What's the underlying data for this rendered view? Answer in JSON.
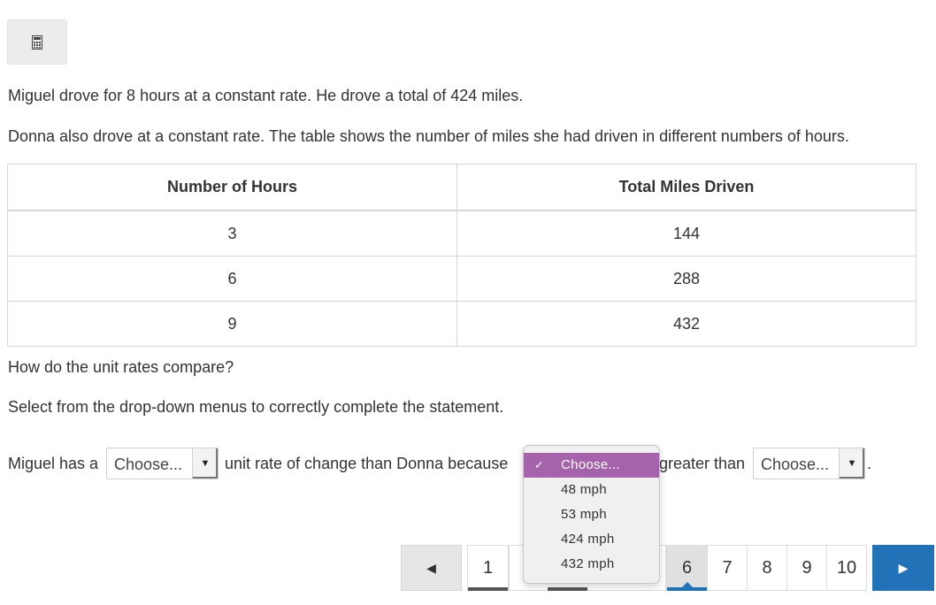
{
  "toolbar": {
    "calculator_icon": "calculator-icon"
  },
  "passage": {
    "line1": "Miguel drove for 8 hours at a constant rate. He drove a total of 424 miles.",
    "line2": "Donna also drove at a constant rate. The table shows the number of miles she had driven in different numbers of hours."
  },
  "table": {
    "headers": [
      "Number of Hours",
      "Total Miles Driven"
    ],
    "rows": [
      [
        "3",
        "144"
      ],
      [
        "6",
        "288"
      ],
      [
        "9",
        "432"
      ]
    ]
  },
  "question": {
    "line1": "How do the unit rates compare?",
    "line2": "Select from the drop-down menus to correctly complete the statement."
  },
  "statement": {
    "part1": "Miguel has a",
    "select1_value": "Choose...",
    "part2": "unit rate of change than Donna because",
    "part3": "greater than",
    "select3_value": "Choose...",
    "end": "."
  },
  "dropdown": {
    "options": [
      "Choose...",
      "48 mph",
      "53 mph",
      "424 mph",
      "432 mph"
    ],
    "selected": "Choose...",
    "highlight_color": "#a463ab"
  },
  "pagination": {
    "prev_icon": "triangle-left-icon",
    "next_icon": "triangle-right-icon",
    "pages": [
      "1",
      "6",
      "7",
      "8",
      "9",
      "10"
    ],
    "current": "6",
    "accent_color": "#2272b8"
  }
}
